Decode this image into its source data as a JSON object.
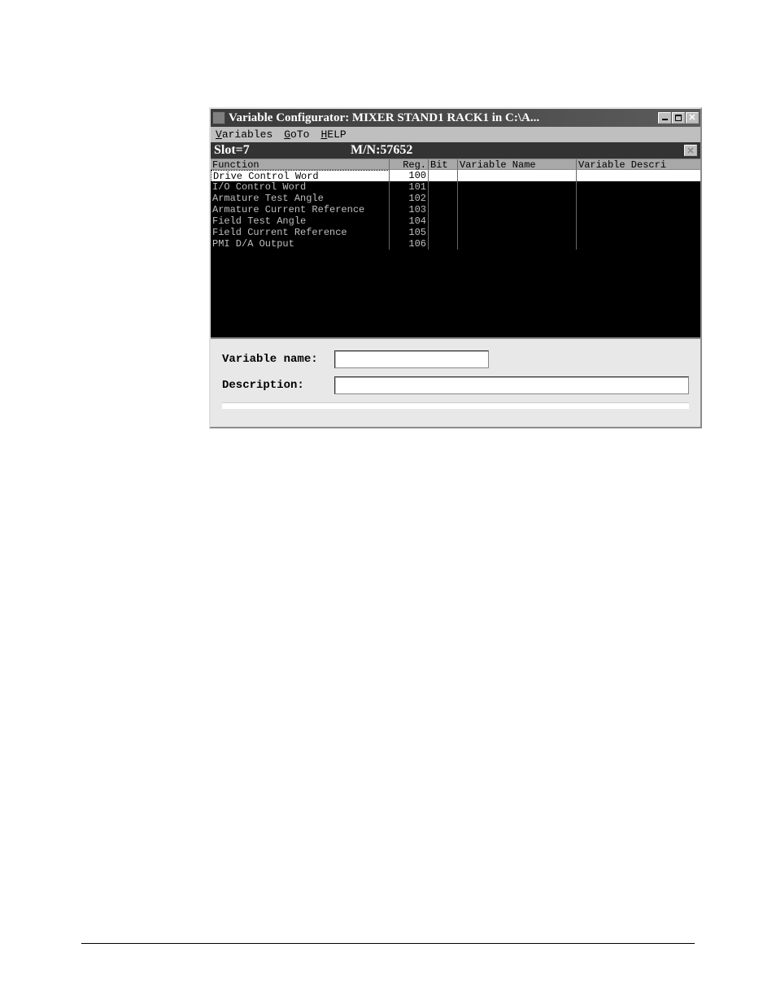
{
  "title": "Variable Configurator:  MIXER STAND1 RACK1 in C:\\A...",
  "menubar": {
    "variables": {
      "pre": "V",
      "rest": "ariables"
    },
    "goto": {
      "pre": "G",
      "rest": "oTo"
    },
    "help": {
      "pre": "H",
      "rest": "ELP"
    }
  },
  "infobar": {
    "slot": "Slot=7",
    "mn": "M/N:57652"
  },
  "columns": {
    "function": "Function",
    "reg": "Reg.",
    "bit": "Bit",
    "varname": "Variable Name",
    "vardesc": "Variable Descri"
  },
  "rows": [
    {
      "function": "Drive Control Word",
      "reg": "100",
      "bit": "",
      "varname": "",
      "vardesc": "",
      "selected": true
    },
    {
      "function": "I/O Control Word",
      "reg": "101",
      "bit": "",
      "varname": "",
      "vardesc": "",
      "selected": false
    },
    {
      "function": "Armature Test Angle",
      "reg": "102",
      "bit": "",
      "varname": "",
      "vardesc": "",
      "selected": false
    },
    {
      "function": "Armature Current Reference",
      "reg": "103",
      "bit": "",
      "varname": "",
      "vardesc": "",
      "selected": false
    },
    {
      "function": "Field Test Angle",
      "reg": "104",
      "bit": "",
      "varname": "",
      "vardesc": "",
      "selected": false
    },
    {
      "function": "Field Current Reference",
      "reg": "105",
      "bit": "",
      "varname": "",
      "vardesc": "",
      "selected": false
    },
    {
      "function": "PMI D/A Output",
      "reg": "106",
      "bit": "",
      "varname": "",
      "vardesc": "",
      "selected": false
    }
  ],
  "form": {
    "varname_label": "Variable name:",
    "desc_label": "Description:",
    "varname_value": "",
    "desc_value": ""
  }
}
